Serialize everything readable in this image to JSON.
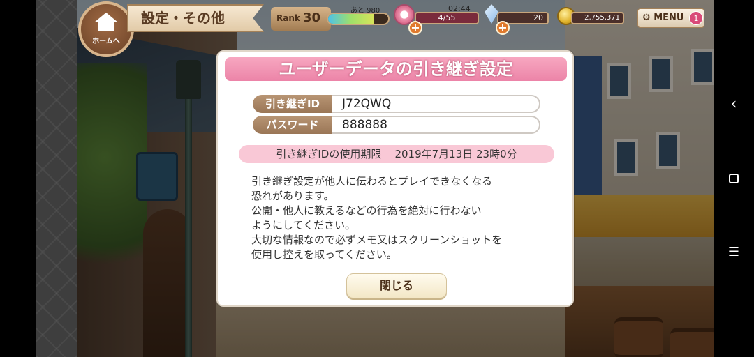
{
  "hud": {
    "home_label": "ホームへ",
    "screen_title": "設定・その他",
    "rank_label": "Rank",
    "rank_value": "30",
    "exp_next_label": "あと 980",
    "exp_progress": 0.75,
    "stamina_timer": "02:44",
    "stamina_value": "4/55",
    "gem_value": "20",
    "coin_value": "2,755,371",
    "menu_label": "MENU",
    "menu_badge": "1"
  },
  "dialog": {
    "title": "ユーザーデータの引き継ぎ設定",
    "fields": [
      {
        "label": "引き継ぎID",
        "value": "J72QWQ"
      },
      {
        "label": "パスワード",
        "value": "888888"
      }
    ],
    "expiry_label": "引き継ぎIDの使用期限",
    "expiry_value": "2019年7月13日 23時0分",
    "warning_lines": [
      "引き継ぎ設定が他人に伝わるとプレイできなくなる",
      "恐れがあります。",
      "公開・他人に教えるなどの行為を絶対に行わない",
      "ようにしてください。",
      "大切な情報なので必ずメモ又はスクリーンショットを",
      "使用し控えを取ってください。"
    ],
    "close_label": "閉じる"
  },
  "nav": {
    "back_icon": "chevron-left",
    "home_icon": "square",
    "menu_icon": "hamburger"
  }
}
